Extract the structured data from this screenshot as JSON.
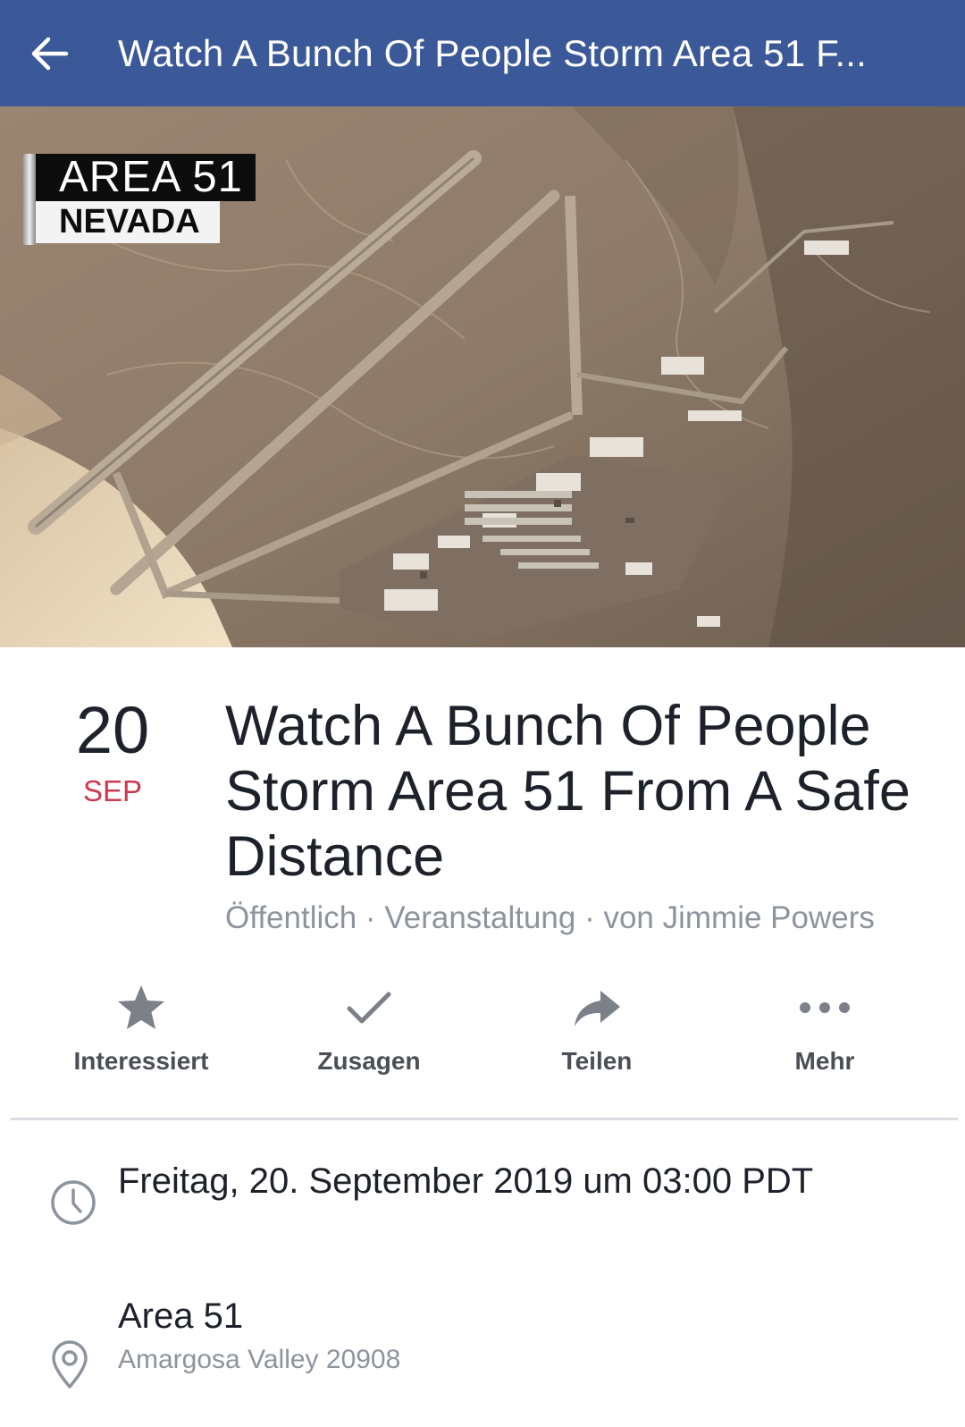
{
  "header": {
    "title": "Watch A Bunch Of People Storm Area 51 F...",
    "back_icon": "back-arrow-icon",
    "background_color": "#3b5998"
  },
  "cover": {
    "chyron_line1": "AREA 51",
    "chyron_line2": "NEVADA"
  },
  "event": {
    "day": "20",
    "month": "SEP",
    "title": "Watch A Bunch Of People Storm Area 51 From A Safe Distance",
    "meta": "Öffentlich · Veranstaltung · von Jimmie Powers"
  },
  "actions": [
    {
      "label": "Interessiert",
      "icon": "star-icon"
    },
    {
      "label": "Zusagen",
      "icon": "check-icon"
    },
    {
      "label": "Teilen",
      "icon": "share-icon"
    },
    {
      "label": "Mehr",
      "icon": "more-icon"
    }
  ],
  "details": {
    "datetime": "Freitag, 20. September 2019 um 03:00 PDT",
    "location_name": "Area 51",
    "location_address": "Amargosa Valley 20908"
  },
  "colors": {
    "accent_date": "#d0384f",
    "secondary_text": "#8d949e"
  }
}
